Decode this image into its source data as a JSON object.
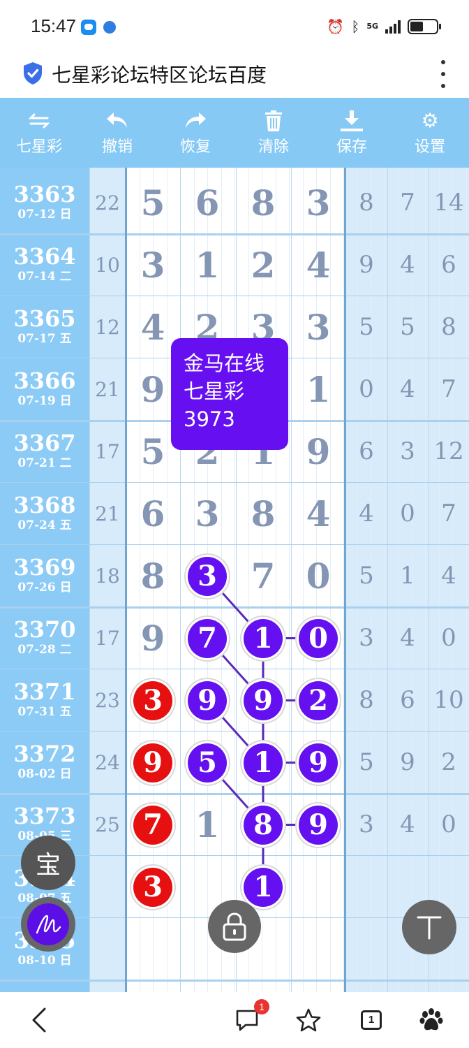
{
  "status": {
    "time": "15:47",
    "network": "5G"
  },
  "browser": {
    "title": "七星彩论坛特区论坛百度",
    "tab_count": "1",
    "message_badge": "1"
  },
  "toolbar": {
    "items": [
      {
        "label": "七星彩",
        "icon": "swap-arrows-icon"
      },
      {
        "label": "撤销",
        "icon": "undo-icon"
      },
      {
        "label": "恢复",
        "icon": "redo-icon"
      },
      {
        "label": "清除",
        "icon": "trash-icon"
      },
      {
        "label": "保存",
        "icon": "download-icon"
      },
      {
        "label": "设置",
        "icon": "gear-icon"
      }
    ]
  },
  "table": {
    "rows": [
      {
        "issue": "3363",
        "date": "07-12 日",
        "sum": "22",
        "digits": [
          "5",
          "6",
          "8",
          "3"
        ],
        "right": [
          "8",
          "7",
          "14"
        ]
      },
      {
        "issue": "3364",
        "date": "07-14 二",
        "sum": "10",
        "digits": [
          "3",
          "1",
          "2",
          "4"
        ],
        "right": [
          "9",
          "4",
          "6"
        ]
      },
      {
        "issue": "3365",
        "date": "07-17 五",
        "sum": "12",
        "digits": [
          "4",
          "2",
          "3",
          "3"
        ],
        "right": [
          "5",
          "5",
          "8"
        ]
      },
      {
        "issue": "3366",
        "date": "07-19 日",
        "sum": "21",
        "digits": [
          "9",
          "",
          "",
          "1"
        ],
        "right": [
          "0",
          "4",
          "7"
        ]
      },
      {
        "issue": "3367",
        "date": "07-21 二",
        "sum": "17",
        "digits": [
          "5",
          "2",
          "1",
          "9"
        ],
        "right": [
          "6",
          "3",
          "12"
        ]
      },
      {
        "issue": "3368",
        "date": "07-24 五",
        "sum": "21",
        "digits": [
          "6",
          "3",
          "8",
          "4"
        ],
        "right": [
          "4",
          "0",
          "7"
        ]
      },
      {
        "issue": "3369",
        "date": "07-26 日",
        "sum": "18",
        "digits": [
          "8",
          "3",
          "7",
          "0"
        ],
        "right": [
          "5",
          "1",
          "4"
        ]
      },
      {
        "issue": "3370",
        "date": "07-28 二",
        "sum": "17",
        "digits": [
          "9",
          "7",
          "1",
          "0"
        ],
        "right": [
          "3",
          "4",
          "0"
        ]
      },
      {
        "issue": "3371",
        "date": "07-31 五",
        "sum": "23",
        "digits": [
          "3",
          "9",
          "9",
          "2"
        ],
        "right": [
          "8",
          "6",
          "10"
        ]
      },
      {
        "issue": "3372",
        "date": "08-02 日",
        "sum": "24",
        "digits": [
          "9",
          "5",
          "1",
          "9"
        ],
        "right": [
          "5",
          "9",
          "2"
        ]
      },
      {
        "issue": "3373",
        "date": "08-05 三",
        "sum": "25",
        "digits": [
          "7",
          "1",
          "8",
          "9"
        ],
        "right": [
          "3",
          "4",
          "0"
        ]
      },
      {
        "issue": "3374",
        "date": "08-07 五",
        "sum": "",
        "digits": [
          "3",
          "",
          "1",
          ""
        ],
        "right": [
          "",
          "",
          ""
        ]
      },
      {
        "issue": "3375",
        "date": "08-10 日",
        "sum": "",
        "digits": [
          "",
          "",
          "",
          ""
        ],
        "right": [
          "",
          "",
          ""
        ]
      }
    ],
    "balls": [
      {
        "row": 6,
        "col": 1,
        "color": "purple"
      },
      {
        "row": 7,
        "col": 1,
        "color": "purple"
      },
      {
        "row": 7,
        "col": 2,
        "color": "purple"
      },
      {
        "row": 7,
        "col": 3,
        "color": "purple"
      },
      {
        "row": 8,
        "col": 0,
        "color": "red"
      },
      {
        "row": 8,
        "col": 1,
        "color": "purple"
      },
      {
        "row": 8,
        "col": 2,
        "color": "purple"
      },
      {
        "row": 8,
        "col": 3,
        "color": "purple"
      },
      {
        "row": 9,
        "col": 0,
        "color": "red"
      },
      {
        "row": 9,
        "col": 1,
        "color": "purple"
      },
      {
        "row": 9,
        "col": 2,
        "color": "purple"
      },
      {
        "row": 9,
        "col": 3,
        "color": "purple"
      },
      {
        "row": 10,
        "col": 0,
        "color": "red"
      },
      {
        "row": 10,
        "col": 2,
        "color": "purple"
      },
      {
        "row": 10,
        "col": 3,
        "color": "purple"
      },
      {
        "row": 11,
        "col": 0,
        "color": "red"
      },
      {
        "row": 11,
        "col": 2,
        "color": "purple"
      }
    ],
    "links": [
      [
        [
          6,
          1
        ],
        [
          7,
          2
        ]
      ],
      [
        [
          7,
          2
        ],
        [
          7,
          3
        ]
      ],
      [
        [
          7,
          1
        ],
        [
          8,
          2
        ]
      ],
      [
        [
          7,
          2
        ],
        [
          8,
          2
        ]
      ],
      [
        [
          8,
          2
        ],
        [
          8,
          3
        ]
      ],
      [
        [
          8,
          1
        ],
        [
          9,
          2
        ]
      ],
      [
        [
          8,
          2
        ],
        [
          9,
          2
        ]
      ],
      [
        [
          9,
          2
        ],
        [
          9,
          3
        ]
      ],
      [
        [
          9,
          1
        ],
        [
          10,
          2
        ]
      ],
      [
        [
          9,
          2
        ],
        [
          10,
          2
        ]
      ],
      [
        [
          10,
          2
        ],
        [
          10,
          3
        ]
      ],
      [
        [
          10,
          2
        ],
        [
          11,
          2
        ]
      ]
    ]
  },
  "popup": {
    "line1": "金马在线",
    "line2": "七星彩",
    "line3": "3973"
  },
  "fab": {
    "bao_label": "宝",
    "t_label": "T"
  },
  "colors": {
    "toolbar_bg": "#87c9f5",
    "ball_red": "#e61010",
    "ball_purple": "#6410f0",
    "popup_bg": "#6610f2"
  }
}
